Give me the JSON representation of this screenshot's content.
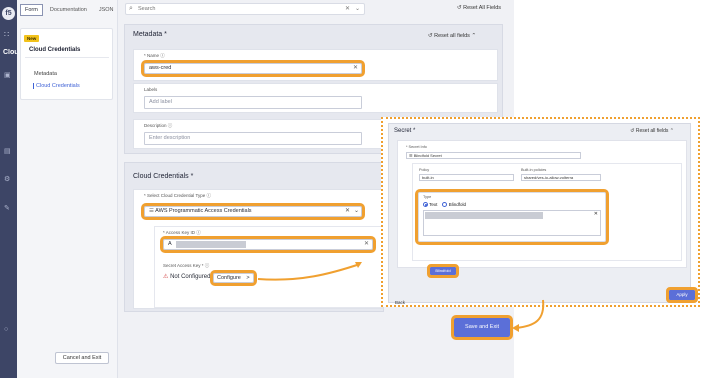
{
  "app": {
    "cloud_label": "Clou"
  },
  "left_panel": {
    "tabs": [
      "Form",
      "Documentation",
      "JSON"
    ],
    "new_badge": "New",
    "nav_title": "Cloud Credentials",
    "nav_items": [
      "Metadata",
      "Cloud Credentials"
    ],
    "cancel_label": "Cancel and Exit"
  },
  "top": {
    "search_placeholder": "Search",
    "reset_all": "Reset All Fields"
  },
  "metadata": {
    "title": "Metadata *",
    "reset_label": "Reset all fields",
    "name_label": "* Name",
    "name_value": "aws-cred",
    "labels_label": "Labels",
    "labels_placeholder": "Add label",
    "description_label": "Description",
    "description_placeholder": "Enter description"
  },
  "cloud_credentials": {
    "title": "Cloud Credentials *",
    "type_label": "* Select Cloud Credential Type",
    "type_value": "AWS Programmatic Access Credentials",
    "access_key_label": "* Access Key ID",
    "access_key_value": "A",
    "secret_label": "Secret Access Key *",
    "not_configured": "Not Configured",
    "configure_label": "Configure",
    "configure_chevron": ">"
  },
  "secret_panel": {
    "title": "Secret *",
    "reset_label": "Reset all fields",
    "secret_info_label": "* Secret Info",
    "secret_info_value": "Blindfold Secret",
    "policy_label": "Policy",
    "policy_value": "built-in",
    "built_in_label": "Built-in policies",
    "built_in_value": "shared/ves-io-allow-volterra",
    "type_label": "Type",
    "radio_text": "Text",
    "radio_blindfold": "Blindfold",
    "blindfold_button": "Blindfold",
    "back_label": "Back",
    "apply_label": "Apply"
  },
  "save_label": "Save and Exit",
  "colors": {
    "highlight": "#f0a030",
    "primary": "#5b6fd8",
    "sidebar": "#3d4566",
    "link": "#3f62d6"
  }
}
